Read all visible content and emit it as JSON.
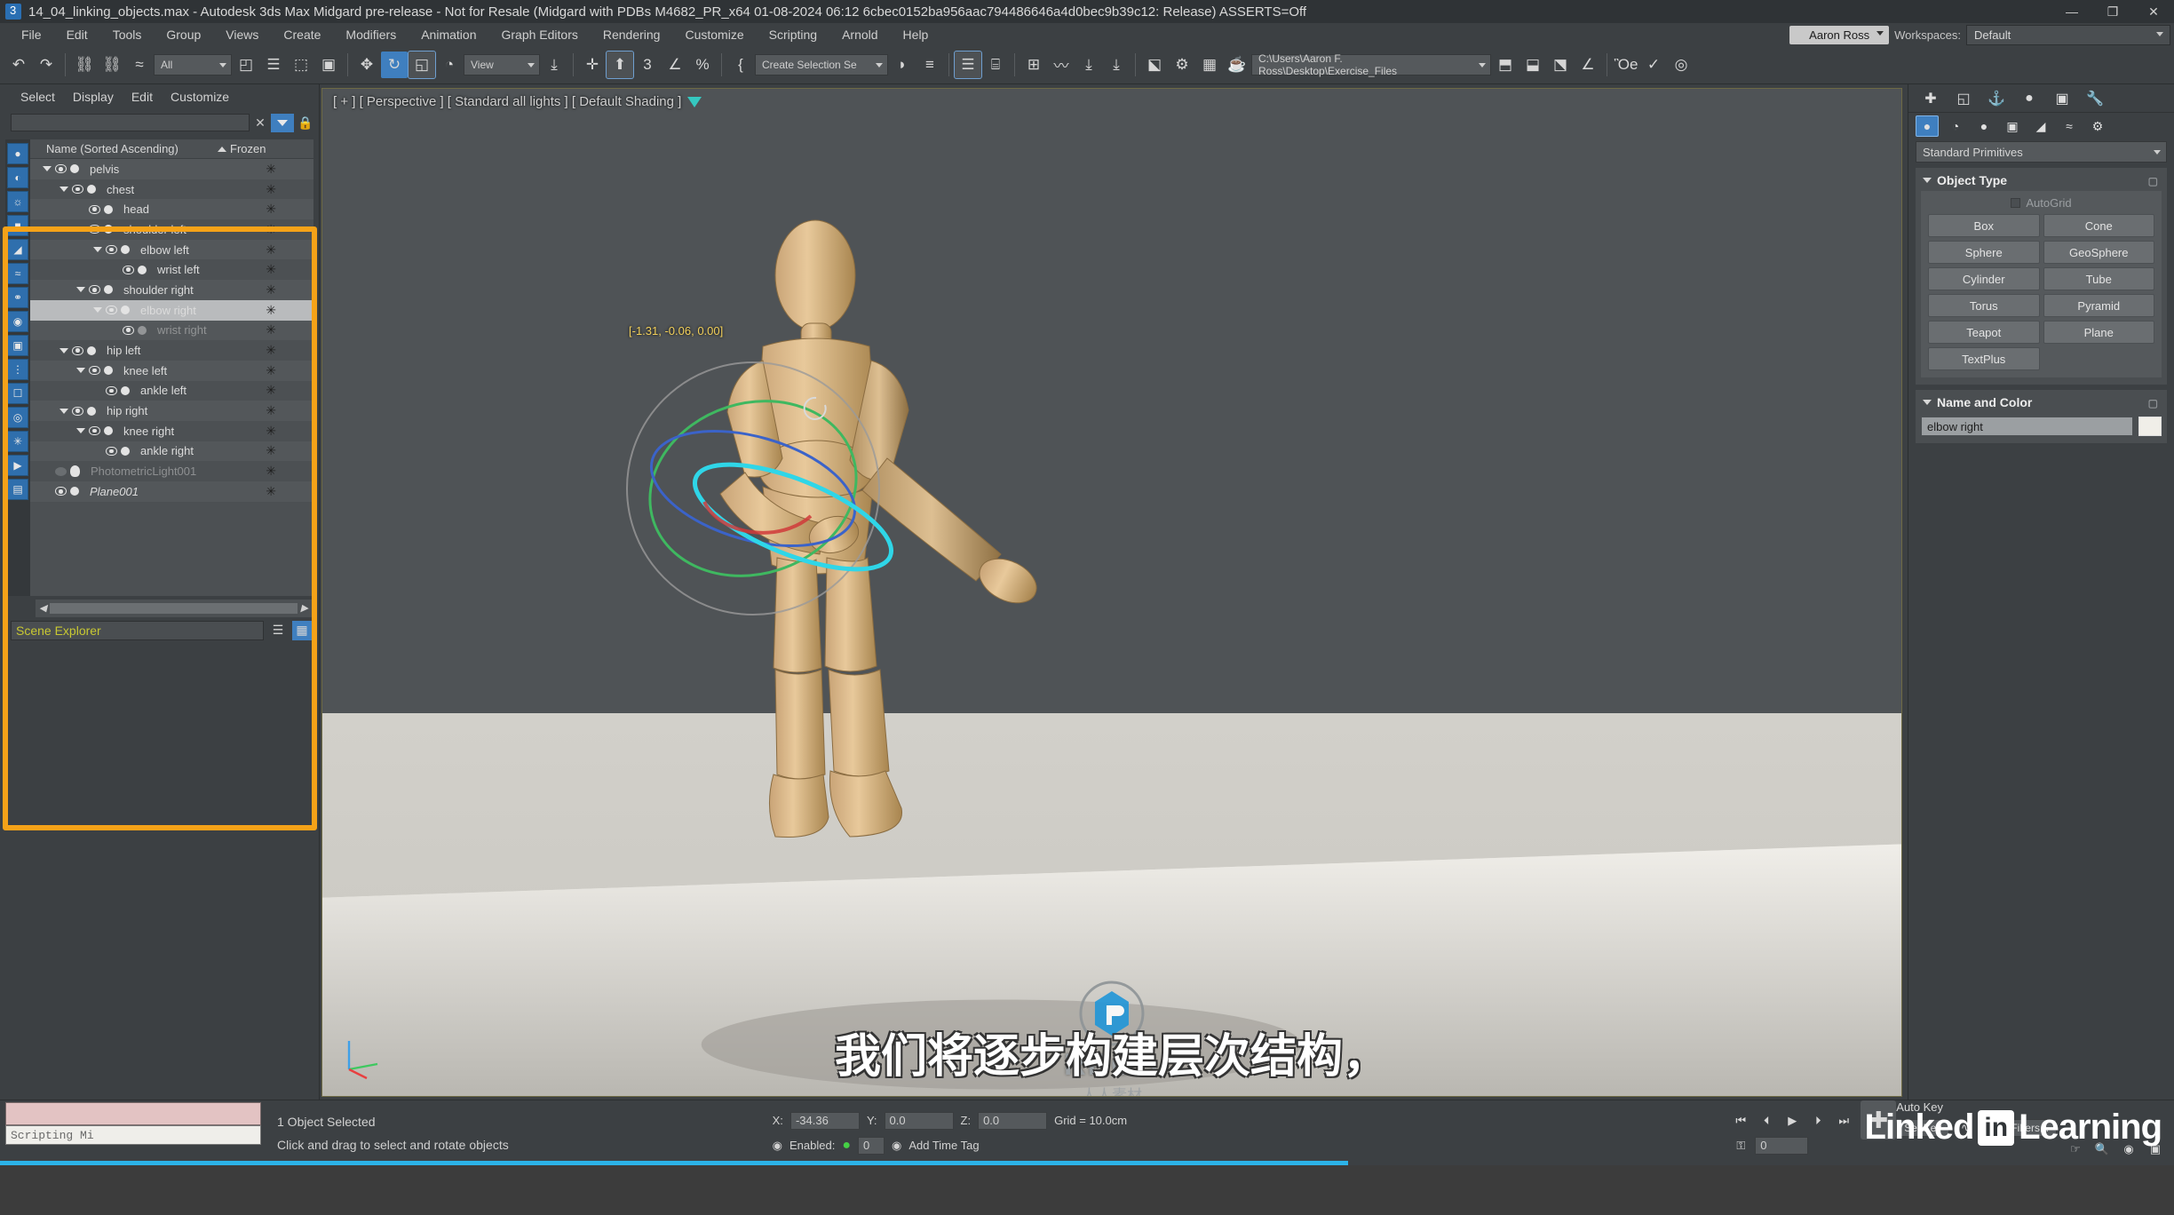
{
  "window": {
    "title": "14_04_linking_objects.max - Autodesk 3ds Max Midgard pre-release - Not for Resale (Midgard with PDBs M4682_PR_x64 01-08-2024 06:12 6cbec0152ba956aac794486646a4d0bec9b39c12: Release) ASSERTS=Off",
    "minimize": "—",
    "maximize": "❐",
    "close": "✕"
  },
  "menu": {
    "items": [
      "File",
      "Edit",
      "Tools",
      "Group",
      "Views",
      "Create",
      "Modifiers",
      "Animation",
      "Graph Editors",
      "Rendering",
      "Customize",
      "Scripting",
      "Arnold",
      "Help"
    ],
    "user": "Aaron Ross",
    "workspaces_label": "Workspaces:",
    "workspace": "Default"
  },
  "toolbar": {
    "undo": "↶",
    "redo": "↷",
    "select_and_link": "⛓",
    "unlink": "⛓",
    "bind_to_space_warp": "≈",
    "selection_filter": "All",
    "select_object": "◰",
    "select_by_name": "☰",
    "rect_selection_region": "⬚",
    "window_crossing": "▣",
    "select_and_move": "✥",
    "select_and_rotate": "↻",
    "select_and_scale": "◱",
    "placement_tool": "◔",
    "reference_coord_system": "View",
    "use_pivot_center": "⤓",
    "select_and_manipulate": "✛",
    "snap_toggle": "⬆",
    "angle_snap": "3",
    "percent_snap": "∠",
    "spinner_snap": "%",
    "named_selection_sets": "↕",
    "edit_named_selection": "{",
    "selection_set_box": "Create Selection Se",
    "mirror": "◗",
    "align": "≡",
    "layer_explorer": "⌸",
    "scene_explorer": "☰",
    "ribbon": "⊞",
    "curve_editor": "〰",
    "schematic_view": "⤓",
    "material_editor": "⤓",
    "render_setup": "⚙",
    "render_frame_window": "▦",
    "render_production": "☕",
    "project_path": "C:\\Users\\Aaron F. Ross\\Desktop\\Exercise_Files",
    "render_in_iray": "⬒",
    "open_asset_tracking": "⬓",
    "state_sets": "⬔",
    "particle_view": "⬕",
    "save_file": "Ὃe",
    "check_mark": "✓",
    "help_circle": "◎"
  },
  "scene_explorer": {
    "menu": [
      "Select",
      "Display",
      "Edit",
      "Customize"
    ],
    "search_placeholder": "",
    "clear_icon": "✕",
    "filter_icon": "filter",
    "lock_icon": "🔒",
    "col_name": "Name (Sorted Ascending)",
    "col_frozen": "Frozen",
    "sort_arrow": "▲",
    "bottom_name": "Scene Explorer",
    "items": [
      {
        "label": "pelvis",
        "indent": 0,
        "arrow": true,
        "eye": true,
        "dot": true,
        "sel": false,
        "italic": false,
        "dim": false
      },
      {
        "label": "chest",
        "indent": 1,
        "arrow": true,
        "eye": true,
        "dot": true,
        "sel": false,
        "italic": false,
        "dim": false
      },
      {
        "label": "head",
        "indent": 2,
        "arrow": false,
        "eye": true,
        "dot": true,
        "sel": false,
        "italic": false,
        "dim": false
      },
      {
        "label": "shoulder left",
        "indent": 2,
        "arrow": true,
        "eye": true,
        "dot": true,
        "sel": false,
        "italic": false,
        "dim": false
      },
      {
        "label": "elbow left",
        "indent": 3,
        "arrow": true,
        "eye": true,
        "dot": true,
        "sel": false,
        "italic": false,
        "dim": false
      },
      {
        "label": "wrist left",
        "indent": 4,
        "arrow": false,
        "eye": true,
        "dot": true,
        "sel": false,
        "italic": false,
        "dim": false
      },
      {
        "label": "shoulder right",
        "indent": 2,
        "arrow": true,
        "eye": true,
        "dot": true,
        "sel": false,
        "italic": false,
        "dim": false
      },
      {
        "label": "elbow right",
        "indent": 3,
        "arrow": true,
        "eye": true,
        "dot": true,
        "sel": true,
        "italic": false,
        "dim": false
      },
      {
        "label": "wrist right",
        "indent": 4,
        "arrow": false,
        "eye": true,
        "dot": true,
        "sel": false,
        "italic": false,
        "dim": true
      },
      {
        "label": "hip left",
        "indent": 1,
        "arrow": true,
        "eye": true,
        "dot": true,
        "sel": false,
        "italic": false,
        "dim": false
      },
      {
        "label": "knee left",
        "indent": 2,
        "arrow": true,
        "eye": true,
        "dot": true,
        "sel": false,
        "italic": false,
        "dim": false
      },
      {
        "label": "ankle left",
        "indent": 3,
        "arrow": false,
        "eye": true,
        "dot": true,
        "sel": false,
        "italic": false,
        "dim": false
      },
      {
        "label": "hip right",
        "indent": 1,
        "arrow": true,
        "eye": true,
        "dot": true,
        "sel": false,
        "italic": false,
        "dim": false
      },
      {
        "label": "knee right",
        "indent": 2,
        "arrow": true,
        "eye": true,
        "dot": true,
        "sel": false,
        "italic": false,
        "dim": false
      },
      {
        "label": "ankle right",
        "indent": 3,
        "arrow": false,
        "eye": true,
        "dot": true,
        "sel": false,
        "italic": false,
        "dim": false
      },
      {
        "label": "PhotometricLight001",
        "indent": 0,
        "arrow": false,
        "eye": false,
        "dot": false,
        "sel": false,
        "italic": false,
        "dim": true
      },
      {
        "label": "Plane001",
        "indent": 0,
        "arrow": false,
        "eye": true,
        "dot": true,
        "sel": false,
        "italic": true,
        "dim": false
      }
    ],
    "frozen_glyph": "✳"
  },
  "viewport": {
    "label": "[ + ] [ Perspective ] [ Standard all lights ] [ Default Shading ]",
    "coordinate_readout": "[-1.31, -0.06, 0.00]"
  },
  "command_panel": {
    "tabs": [
      "create-tab",
      "modify-tab",
      "hierarchy-tab",
      "motion-tab",
      "display-tab",
      "utilities-tab"
    ],
    "tab_glyphs": [
      "✚",
      "◱",
      "⚓",
      "●",
      "▣",
      "🔧"
    ],
    "categories": [
      "geometry",
      "shapes",
      "lights",
      "cameras",
      "helpers",
      "space-warps",
      "systems"
    ],
    "category_glyphs": [
      "●",
      "◔",
      "●",
      "▣",
      "◢",
      "≈",
      "⚙"
    ],
    "primitive_dropdown": "Standard Primitives",
    "object_type_header": "Object Type",
    "autogrid_label": "AutoGrid",
    "buttons": [
      "Box",
      "Cone",
      "Sphere",
      "GeoSphere",
      "Cylinder",
      "Tube",
      "Torus",
      "Pyramid",
      "Teapot",
      "Plane",
      "TextPlus"
    ],
    "name_and_color_header": "Name and Color",
    "object_name": "elbow right",
    "object_color": "#f0eee8"
  },
  "status_bar": {
    "maxscript_mini": "Scripting Mi",
    "objects_selected": "1 Object Selected",
    "prompt": "Click and drag to select and rotate objects",
    "x_label": "X:",
    "x_value": "-34.36",
    "y_label": "Y:",
    "y_value": "0.0",
    "z_label": "Z:",
    "z_value": "0.0",
    "grid_label": "Grid = 10.0cm",
    "enabled_label": "Enabled:",
    "key_count": "0",
    "add_time_tag": "Add Time Tag",
    "auto_key": "Auto Key",
    "set_key": "Set Key",
    "key_filters": "Key Filters...",
    "frame_value": "0"
  },
  "time_controls": {
    "go_to_start": "⏮",
    "previous_frame": "⏴",
    "play": "▶",
    "next_frame": "⏵",
    "go_to_end": "⏭",
    "key_mode": "⚿"
  },
  "overlay": {
    "subtitle": "我们将逐步构建层次结构，",
    "watermark_mark": "RRCG",
    "watermark_sub": "人人素材",
    "linkedin_word1": "Linked",
    "linkedin_in": "in",
    "linkedin_word2": "Learning"
  },
  "colors": {
    "accent_orange": "#f5a218",
    "accent_blue": "#3f7fbf",
    "bg": "#3c4043",
    "panel": "#4a4e51"
  }
}
